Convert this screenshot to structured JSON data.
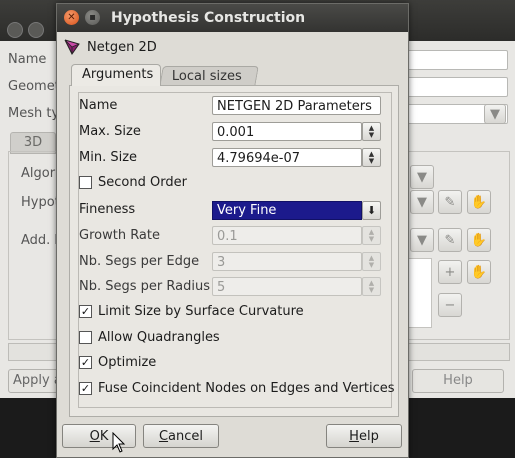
{
  "background_window": {
    "labels": [
      "Name",
      "Geomet",
      "Mesh ty",
      "Algori",
      "Hypot",
      "Add. h"
    ],
    "tab_label": "3D",
    "apply_label": "Apply a",
    "help_label": "Help"
  },
  "dialog": {
    "title": "Hypothesis Construction",
    "algorithm": "Netgen 2D",
    "tabs": [
      "Arguments",
      "Local sizes"
    ],
    "fields": {
      "name": {
        "label": "Name",
        "value": "NETGEN 2D Parameters"
      },
      "max_size": {
        "label": "Max. Size",
        "value": "0.001"
      },
      "min_size": {
        "label": "Min. Size",
        "value": "4.79694e-07"
      },
      "second_order": {
        "label": "Second Order",
        "checked": false
      },
      "fineness": {
        "label": "Fineness",
        "value": "Very Fine"
      },
      "growth_rate": {
        "label": "Growth Rate",
        "value": "0.1"
      },
      "segs_per_edge": {
        "label": "Nb. Segs per Edge",
        "value": "3"
      },
      "segs_per_radius": {
        "label": "Nb. Segs per Radius",
        "value": "5"
      },
      "limit_size": {
        "label": "Limit Size by Surface Curvature",
        "checked": true
      },
      "allow_quads": {
        "label": "Allow Quadrangles",
        "checked": false
      },
      "optimize": {
        "label": "Optimize",
        "checked": true
      },
      "fuse_nodes": {
        "label": "Fuse Coincident Nodes on Edges and Vertices",
        "checked": true
      }
    },
    "buttons": {
      "ok_prefix": "",
      "ok_u": "O",
      "ok_rest": "K",
      "cancel_prefix": "",
      "cancel_u": "C",
      "cancel_rest": "ancel",
      "help_prefix": "",
      "help_u": "H",
      "help_rest": "elp"
    }
  },
  "colors": {
    "selection": "#1c1a8c",
    "close_button": "#d9521a"
  }
}
